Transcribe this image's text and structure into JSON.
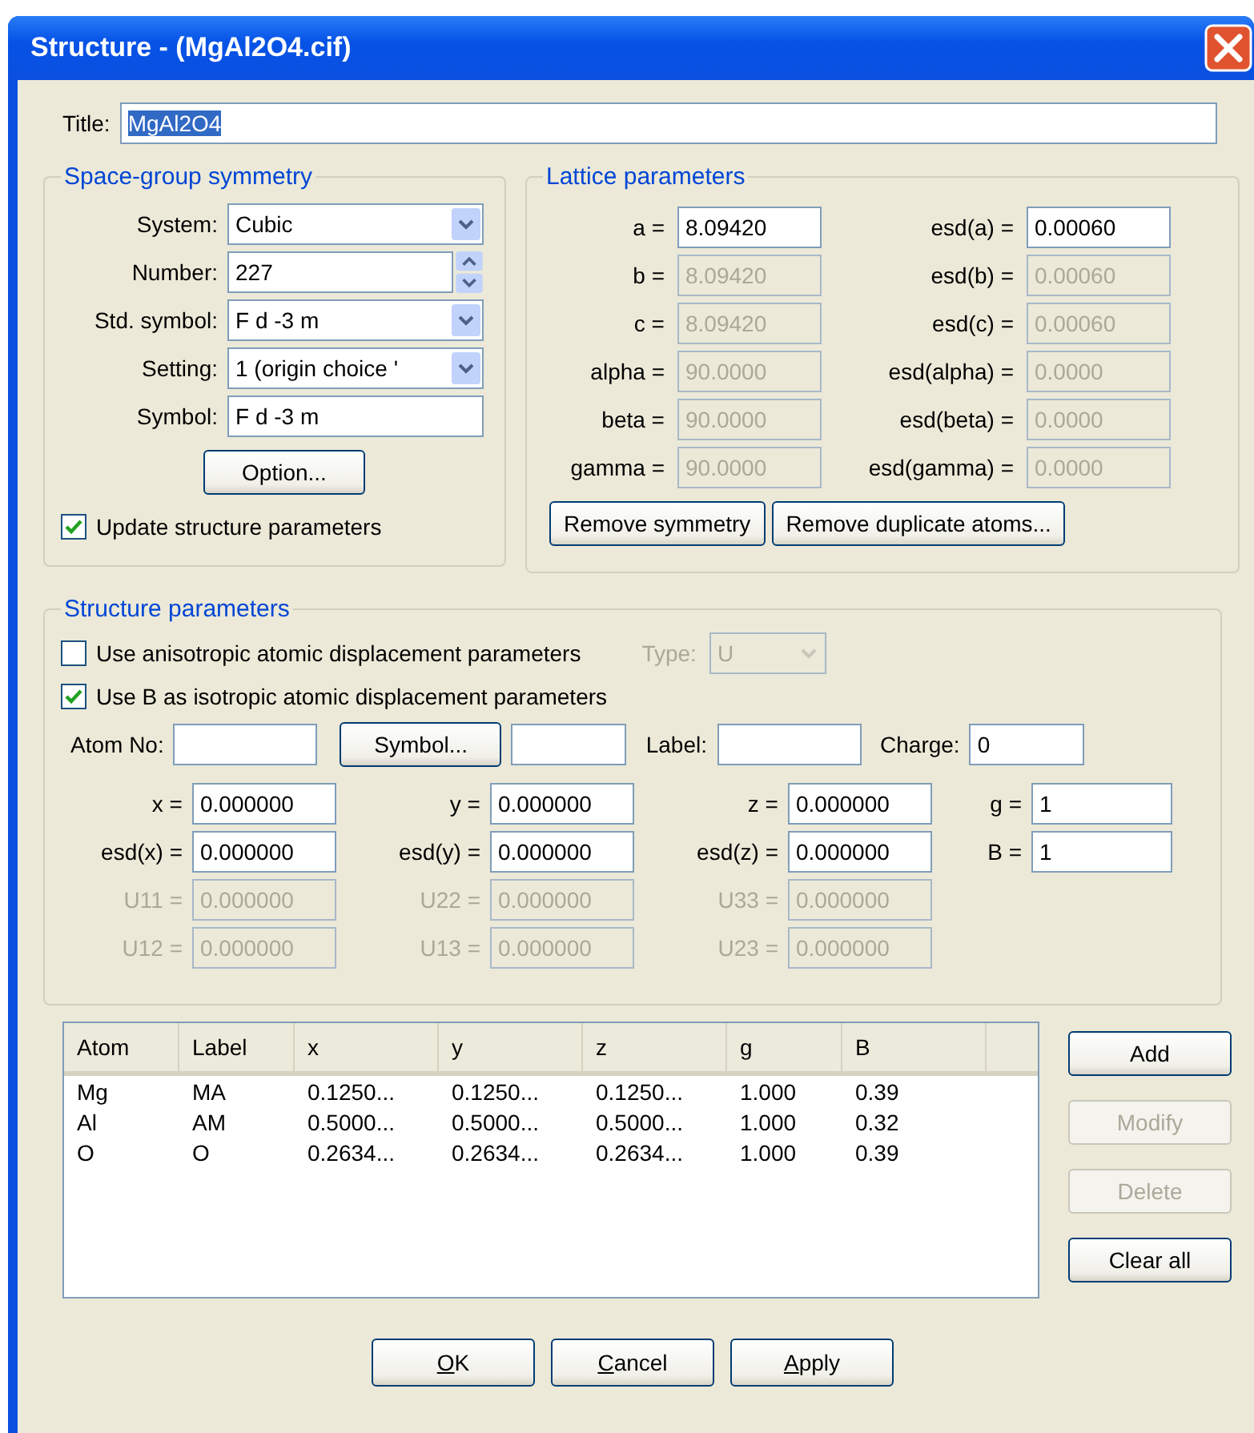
{
  "window": {
    "title": "Structure - (MgAl2O4.cif)"
  },
  "title_field": {
    "label": "Title:",
    "value": "MgAl2O4",
    "highlighted": true
  },
  "space_group": {
    "legend": "Space-group symmetry",
    "fields": [
      {
        "kind": "select",
        "label": "System:",
        "value": "Cubic"
      },
      {
        "kind": "spin",
        "label": "Number:",
        "value": "227"
      },
      {
        "kind": "select",
        "label": "Std. symbol:",
        "value": "F d -3 m"
      },
      {
        "kind": "select",
        "label": "Setting:",
        "value": "1 (origin choice '"
      },
      {
        "kind": "text",
        "label": "Symbol:",
        "value": "F d -3 m"
      }
    ],
    "option_button": "Option...",
    "update_checkbox": {
      "label": "Update structure parameters",
      "checked": true
    }
  },
  "lattice": {
    "legend": "Lattice parameters",
    "rows": [
      {
        "label": "a =",
        "value": "8.09420",
        "disabled": false,
        "esd_label": "esd(a) =",
        "esd_value": "0.00060",
        "esd_disabled": false
      },
      {
        "label": "b =",
        "value": "8.09420",
        "disabled": true,
        "esd_label": "esd(b) =",
        "esd_value": "0.00060",
        "esd_disabled": true
      },
      {
        "label": "c =",
        "value": "8.09420",
        "disabled": true,
        "esd_label": "esd(c) =",
        "esd_value": "0.00060",
        "esd_disabled": true
      },
      {
        "label": "alpha =",
        "value": "90.0000",
        "disabled": true,
        "esd_label": "esd(alpha) =",
        "esd_value": "0.0000",
        "esd_disabled": true
      },
      {
        "label": "beta =",
        "value": "90.0000",
        "disabled": true,
        "esd_label": "esd(beta) =",
        "esd_value": "0.0000",
        "esd_disabled": true
      },
      {
        "label": "gamma =",
        "value": "90.0000",
        "disabled": true,
        "esd_label": "esd(gamma) =",
        "esd_value": "0.0000",
        "esd_disabled": true
      }
    ],
    "buttons": [
      "Remove symmetry",
      "Remove duplicate atoms..."
    ]
  },
  "structure": {
    "legend": "Structure parameters",
    "aniso": {
      "label": "Use anisotropic atomic displacement parameters",
      "checked": false
    },
    "type": {
      "label": "Type:",
      "value": "U",
      "disabled": true
    },
    "iso_b": {
      "label": "Use B as isotropic atomic displacement parameters",
      "checked": true
    },
    "atom_no": {
      "label": "Atom No:"
    },
    "symbol_button": "Symbol...",
    "label_field": {
      "label": "Label:"
    },
    "charge": {
      "label": "Charge:",
      "value": "0"
    },
    "coord_rows": [
      [
        {
          "label": "x =",
          "value": "0.000000",
          "disabled": false
        },
        {
          "label": "y =",
          "value": "0.000000",
          "disabled": false
        },
        {
          "label": "z =",
          "value": "0.000000",
          "disabled": false
        },
        {
          "label": "g =",
          "value": "1",
          "disabled": false
        }
      ],
      [
        {
          "label": "esd(x) =",
          "value": "0.000000",
          "disabled": false
        },
        {
          "label": "esd(y) =",
          "value": "0.000000",
          "disabled": false
        },
        {
          "label": "esd(z) =",
          "value": "0.000000",
          "disabled": false
        },
        {
          "label": "B =",
          "value": "1",
          "disabled": false
        }
      ],
      [
        {
          "label": "U11 =",
          "value": "0.000000",
          "disabled": true
        },
        {
          "label": "U22 =",
          "value": "0.000000",
          "disabled": true
        },
        {
          "label": "U33 =",
          "value": "0.000000",
          "disabled": true
        }
      ],
      [
        {
          "label": "U12 =",
          "value": "0.000000",
          "disabled": true
        },
        {
          "label": "U13 =",
          "value": "0.000000",
          "disabled": true
        },
        {
          "label": "U23 =",
          "value": "0.000000",
          "disabled": true
        }
      ]
    ]
  },
  "table": {
    "columns": [
      "Atom",
      "Label",
      "x",
      "y",
      "z",
      "g",
      "B"
    ],
    "rows": [
      [
        "Mg",
        "MA",
        "0.1250...",
        "0.1250...",
        "0.1250...",
        "1.000",
        "0.39"
      ],
      [
        "Al",
        "AM",
        "0.5000...",
        "0.5000...",
        "0.5000...",
        "1.000",
        "0.32"
      ],
      [
        "O",
        "O",
        "0.2634...",
        "0.2634...",
        "0.2634...",
        "1.000",
        "0.39"
      ]
    ]
  },
  "side_buttons": [
    {
      "label": "Add",
      "disabled": false
    },
    {
      "label": "Modify",
      "disabled": true
    },
    {
      "label": "Delete",
      "disabled": true
    },
    {
      "label": "Clear all",
      "disabled": false
    }
  ],
  "footer_buttons": [
    "OK",
    "Cancel",
    "Apply"
  ]
}
